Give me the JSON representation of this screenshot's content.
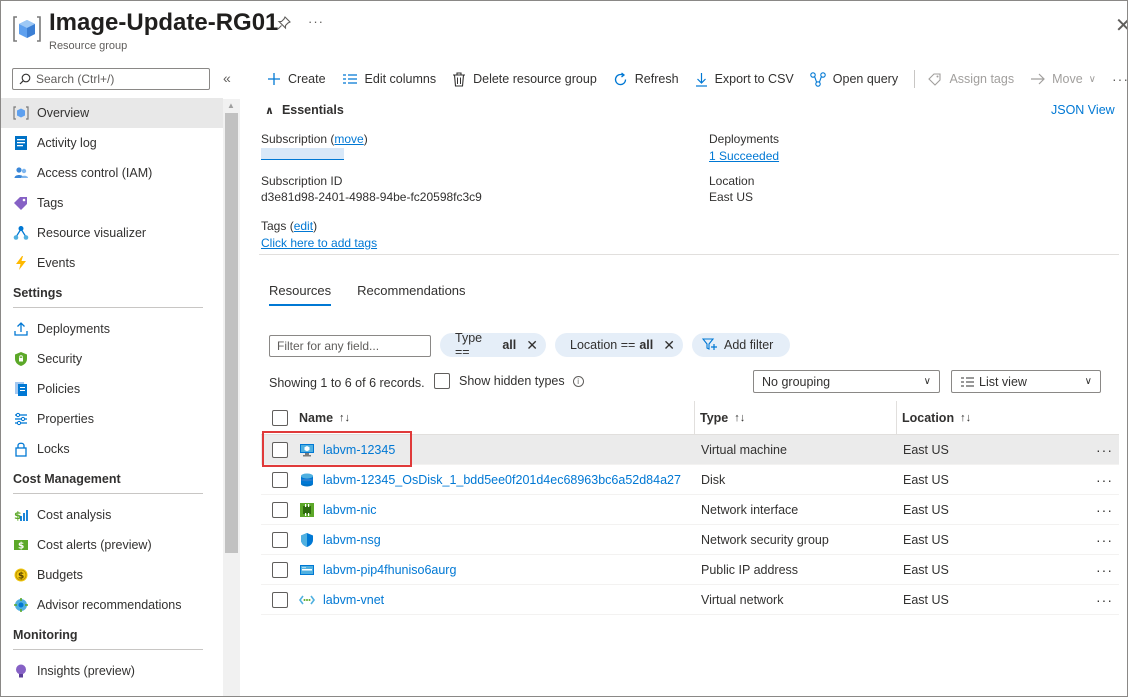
{
  "header": {
    "title": "Image-Update-RG01",
    "subtitle": "Resource group",
    "more": "···",
    "close": "✕"
  },
  "sidebar": {
    "search_placeholder": "Search (Ctrl+/)",
    "collapse": "«",
    "items": [
      {
        "label": "Overview",
        "icon": "overview-icon",
        "active": true
      },
      {
        "label": "Activity log",
        "icon": "activity-log-icon"
      },
      {
        "label": "Access control (IAM)",
        "icon": "people-icon"
      },
      {
        "label": "Tags",
        "icon": "tag-icon"
      },
      {
        "label": "Resource visualizer",
        "icon": "visualizer-icon"
      },
      {
        "label": "Events",
        "icon": "lightning-icon"
      }
    ],
    "sections": [
      {
        "title": "Settings",
        "items": [
          {
            "label": "Deployments",
            "icon": "upload-icon"
          },
          {
            "label": "Security",
            "icon": "shield-icon"
          },
          {
            "label": "Policies",
            "icon": "policy-icon"
          },
          {
            "label": "Properties",
            "icon": "properties-icon"
          },
          {
            "label": "Locks",
            "icon": "lock-icon"
          }
        ]
      },
      {
        "title": "Cost Management",
        "items": [
          {
            "label": "Cost analysis",
            "icon": "cost-analysis-icon"
          },
          {
            "label": "Cost alerts (preview)",
            "icon": "cost-alert-icon"
          },
          {
            "label": "Budgets",
            "icon": "budget-icon"
          },
          {
            "label": "Advisor recommendations",
            "icon": "advisor-icon"
          }
        ]
      },
      {
        "title": "Monitoring",
        "items": [
          {
            "label": "Insights (preview)",
            "icon": "insights-icon"
          }
        ]
      }
    ]
  },
  "toolbar": {
    "create": "Create",
    "edit_columns": "Edit columns",
    "delete_rg": "Delete resource group",
    "refresh": "Refresh",
    "export_csv": "Export to CSV",
    "open_query": "Open query",
    "assign_tags": "Assign tags",
    "move": "Move",
    "more": "···"
  },
  "essentials": {
    "title": "Essentials",
    "json_view": "JSON View",
    "subscription_label": "Subscription",
    "subscription_move": "move",
    "subscription_id_label": "Subscription ID",
    "subscription_id": "d3e81d98-2401-4988-94be-fc20598fc3c9",
    "tags_label": "Tags",
    "tags_edit": "edit",
    "tags_add": "Click here to add tags",
    "deployments_label": "Deployments",
    "deployments_value": "1 Succeeded",
    "location_label": "Location",
    "location_value": "East US"
  },
  "tabs": {
    "resources": "Resources",
    "recommendations": "Recommendations"
  },
  "filters": {
    "placeholder": "Filter for any field...",
    "type_pill_prefix": "Type ==",
    "type_pill_value": "all",
    "location_pill_prefix": "Location ==",
    "location_pill_value": "all",
    "add_filter": "Add filter",
    "showing": "Showing 1 to 6 of 6 records.",
    "show_hidden": "Show hidden types",
    "grouping": "No grouping",
    "view": "List view"
  },
  "table": {
    "headers": {
      "name": "Name",
      "type": "Type",
      "location": "Location"
    },
    "rows": [
      {
        "name": "labvm-12345",
        "type": "Virtual machine",
        "location": "East US",
        "icon": "vm-icon"
      },
      {
        "name": "labvm-12345_OsDisk_1_bdd5ee0f201d4ec68963bc6a52d84a27",
        "type": "Disk",
        "location": "East US",
        "icon": "disk-icon"
      },
      {
        "name": "labvm-nic",
        "type": "Network interface",
        "location": "East US",
        "icon": "nic-icon"
      },
      {
        "name": "labvm-nsg",
        "type": "Network security group",
        "location": "East US",
        "icon": "nsg-icon"
      },
      {
        "name": "labvm-pip4fhuniso6aurg",
        "type": "Public IP address",
        "location": "East US",
        "icon": "public-ip-icon"
      },
      {
        "name": "labvm-vnet",
        "type": "Virtual network",
        "location": "East US",
        "icon": "vnet-icon"
      }
    ],
    "row_more": "···"
  }
}
